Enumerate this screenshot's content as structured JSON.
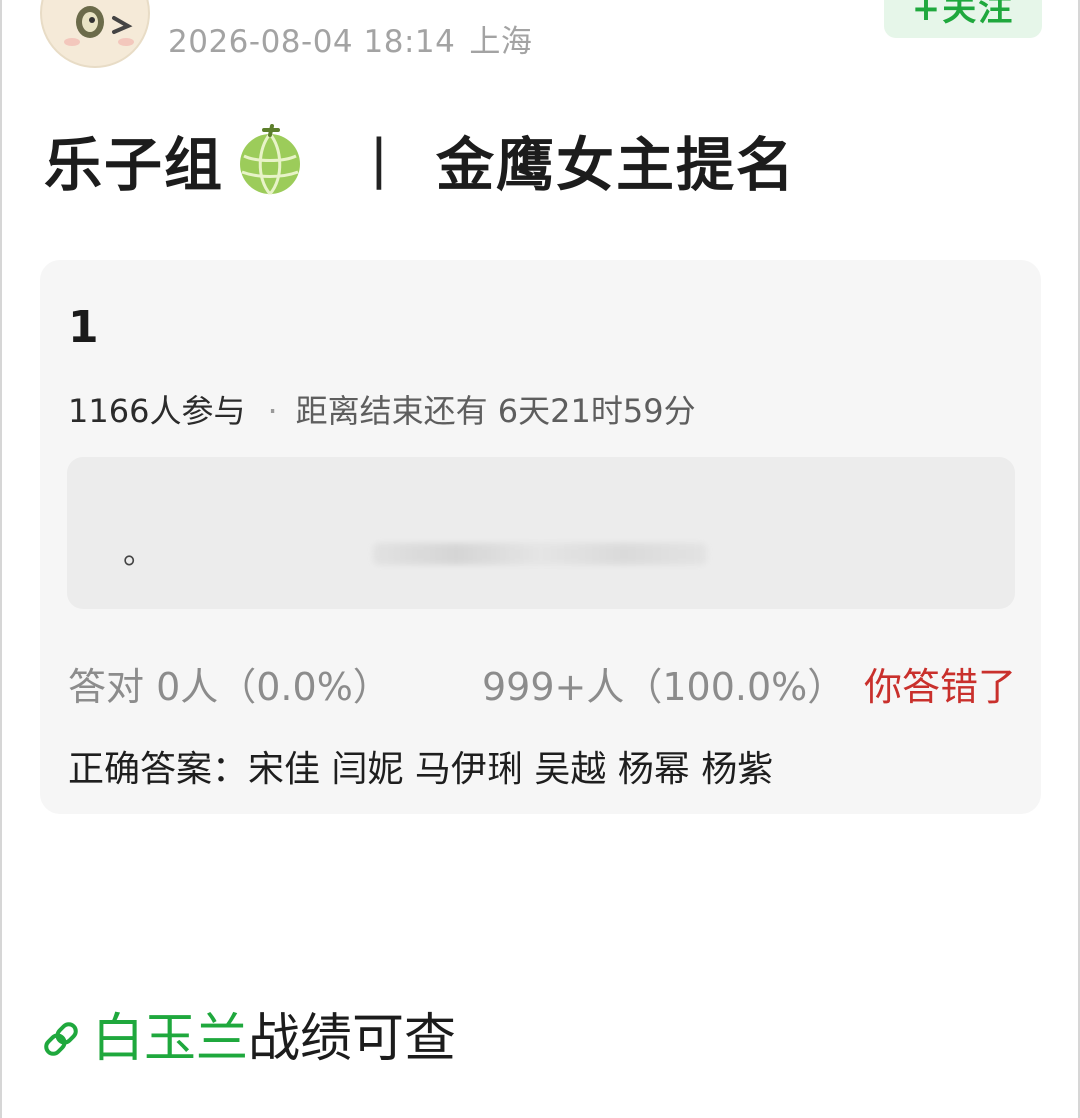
{
  "header": {
    "timestamp": "2026-08-04 18:14",
    "location": "上海",
    "follow_label": "+关注"
  },
  "post": {
    "title_prefix": "乐子组",
    "title_emoji": "melon-emoji",
    "title_separator": "丨",
    "title_suffix": "金鹰女主提名"
  },
  "quiz": {
    "question_number": "1",
    "participants": "1166人参与",
    "separator": "·",
    "countdown": "距离结束还有 6天21时59分",
    "option_mark": "。",
    "correct_stat": "答对 0人（0.0%）",
    "wrong_stat": "999+人（100.0%）",
    "result_label": "你答错了",
    "answer_text": "正确答案：宋佳 闫妮 马伊琍 吴越 杨幂 杨紫"
  },
  "footer_link": {
    "icon": "link-icon",
    "name": "白玉兰",
    "suffix": "战绩可查"
  },
  "colors": {
    "accent_green": "#1fa83d",
    "error_red": "#c9302c",
    "card_bg": "#f6f6f6"
  }
}
